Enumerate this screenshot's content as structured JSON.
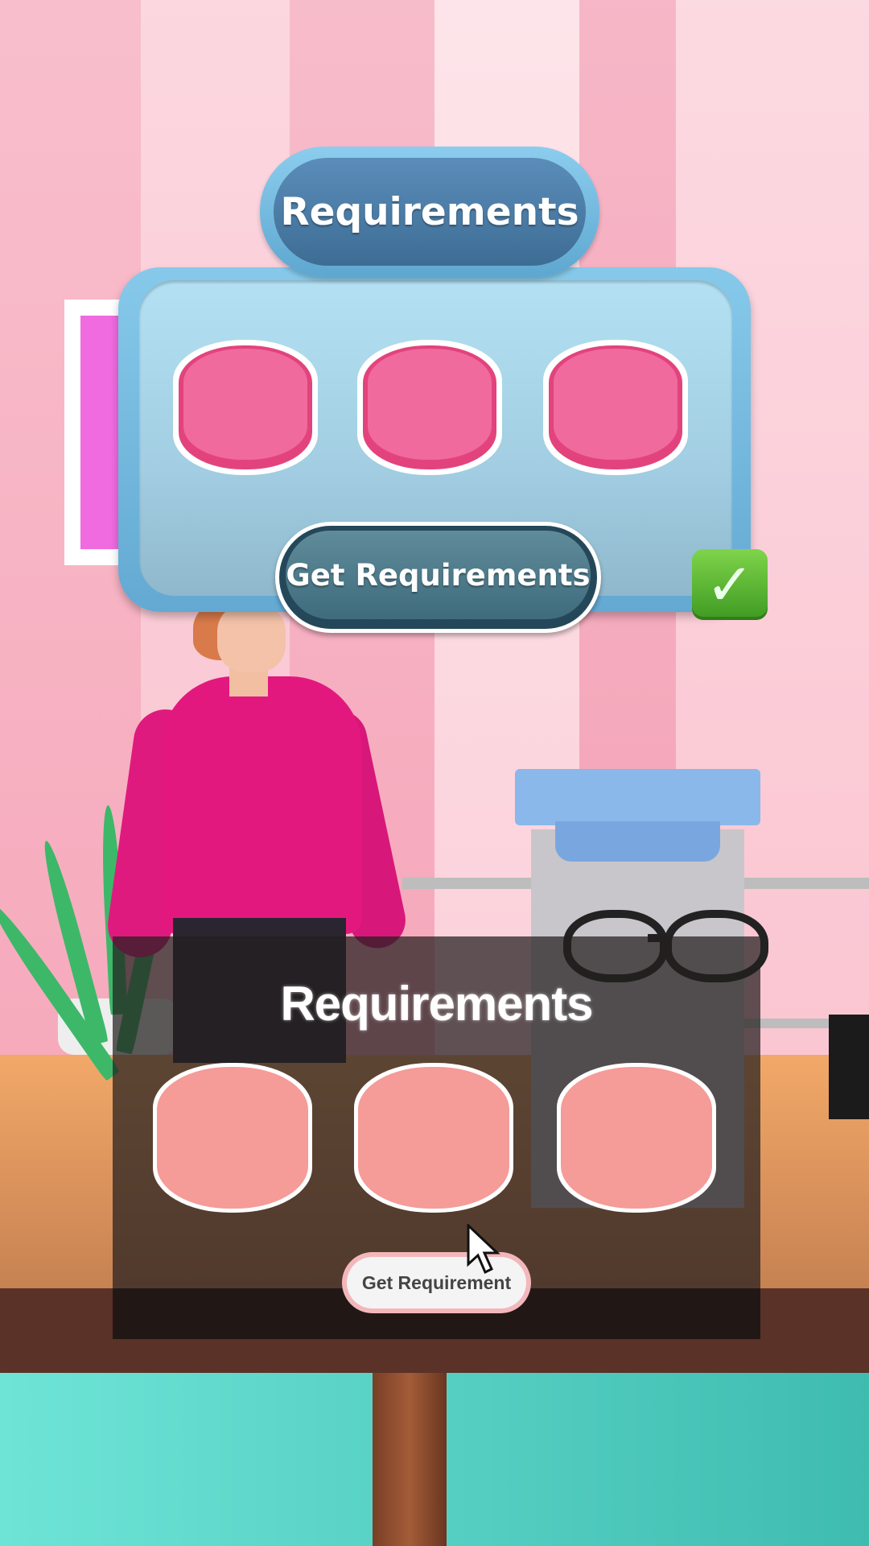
{
  "requirements_panel": {
    "title": "Requirements",
    "slots": [
      "",
      "",
      ""
    ],
    "get_button_label": "Get Requirements",
    "confirm_icon": "checkmark-icon",
    "slot_color": "#f06a9d",
    "panel_color": "#86c9ea"
  },
  "requirements_overlay": {
    "title": "Requirements",
    "slots": [
      "",
      "",
      ""
    ],
    "get_button_label": "Get Requirement",
    "cursor_icon": "mouse-pointer-icon"
  },
  "scene": {
    "icons": [
      "character",
      "aloe-plant",
      "eyeglasses",
      "lens-machine",
      "wall-poster",
      "table"
    ]
  }
}
